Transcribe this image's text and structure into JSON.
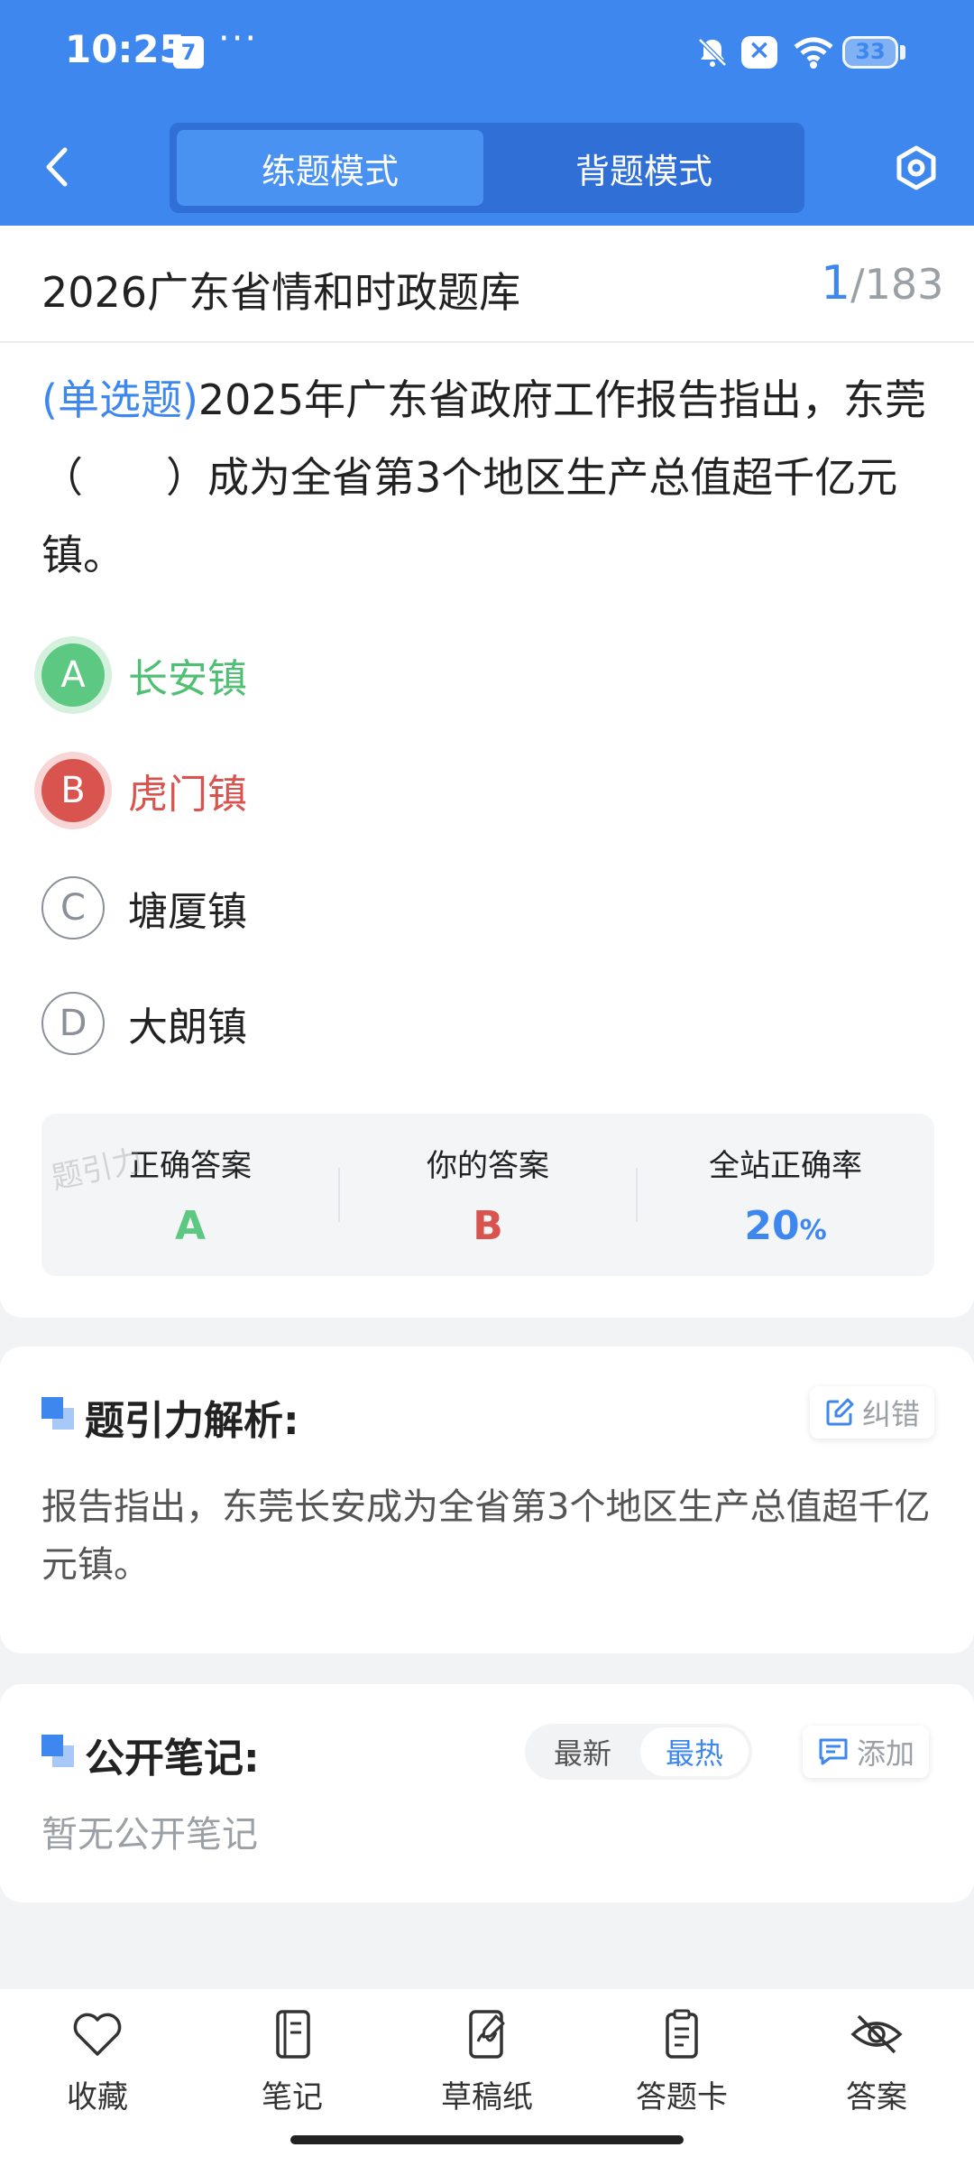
{
  "status_bar": {
    "time": "10:25",
    "calendar_day": "7",
    "overflow": "···",
    "battery": "33"
  },
  "header": {
    "tabs": [
      {
        "label": "练题模式",
        "active": true
      },
      {
        "label": "背题模式",
        "active": false
      }
    ]
  },
  "question_bank": {
    "title": "2026广东省情和时政题库",
    "current": "1",
    "total": "/183"
  },
  "question": {
    "type": "(单选题)",
    "text": "2025年广东省政府工作报告指出，东莞（　　）成为全省第3个地区生产总值超千亿元镇。",
    "options": [
      {
        "letter": "A",
        "text": "长安镇",
        "state": "correct"
      },
      {
        "letter": "B",
        "text": "虎门镇",
        "state": "wrong"
      },
      {
        "letter": "C",
        "text": "塘厦镇",
        "state": "normal"
      },
      {
        "letter": "D",
        "text": "大朗镇",
        "state": "normal"
      }
    ]
  },
  "answer_summary": {
    "correct_label": "正确答案",
    "correct_value": "A",
    "yours_label": "你的答案",
    "yours_value": "B",
    "rate_label": "全站正确率",
    "rate_value": "20",
    "rate_unit": "%",
    "watermark": "题引力"
  },
  "analysis": {
    "title": "题引力解析:",
    "fix_label": "纠错",
    "text": "报告指出，东莞长安成为全省第3个地区生产总值超千亿元镇。"
  },
  "notes": {
    "title": "公开笔记:",
    "sort_latest": "最新",
    "sort_hot": "最热",
    "add_label": "添加",
    "empty_text": "暂无公开笔记"
  },
  "bottom_bar": {
    "items": [
      {
        "label": "收藏",
        "icon": "heart-icon"
      },
      {
        "label": "笔记",
        "icon": "notebook-icon"
      },
      {
        "label": "草稿纸",
        "icon": "draft-icon"
      },
      {
        "label": "答题卡",
        "icon": "clipboard-icon"
      },
      {
        "label": "答案",
        "icon": "eye-off-icon"
      }
    ]
  },
  "colors": {
    "brand": "#3d87ee",
    "correct": "#5cc882",
    "wrong": "#d9534f"
  }
}
